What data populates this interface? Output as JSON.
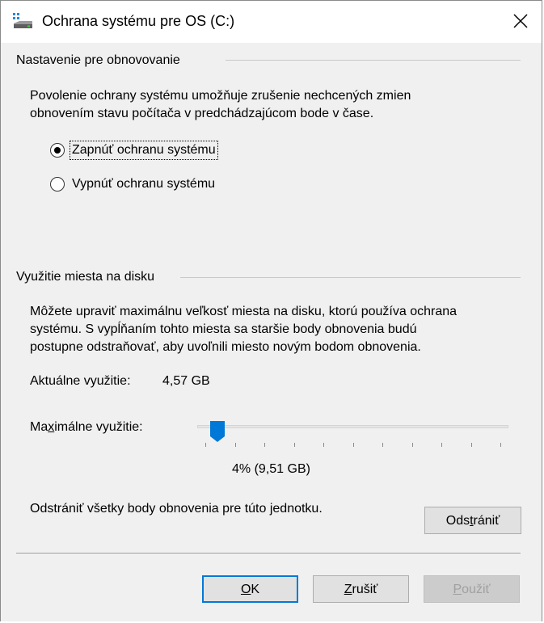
{
  "window": {
    "title": "Ochrana systému pre OS (C:)",
    "icon": "system-protection-icon"
  },
  "restore_settings": {
    "heading": "Nastavenie pre obnovovanie",
    "description_line1": "Povolenie ochrany systému umožňuje zrušenie nechcených zmien",
    "description_line2": "obnovením stavu počítača v predchádzajúcom bode v čase.",
    "options": [
      {
        "label": "Zapnúť ochranu systému",
        "selected": true
      },
      {
        "label": "Vypnúť ochranu systému",
        "selected": false
      }
    ]
  },
  "disk_usage": {
    "heading": "Využitie miesta na disku",
    "description_line1": "Môžete upraviť maximálnu veľkosť miesta na disku, ktorú používa ochrana",
    "description_line2": "systému. S vypĺňaním tohto miesta sa staršie body obnovenia budú",
    "description_line3": "postupne odstraňovať, aby uvoľnili miesto novým bodom obnovenia.",
    "current_label": "Aktuálne využitie:",
    "current_value": "4,57 GB",
    "max_label_pre": "Ma",
    "max_label_mnemonic": "x",
    "max_label_post": "imálne využitie:",
    "slider_percent": 4,
    "slider_value_text": "4% (9,51 GB)",
    "delete_text": "Odstrániť všetky body obnovenia pre túto jednotku.",
    "delete_button_pre": "Ods",
    "delete_button_mnemonic": "t",
    "delete_button_post": "rániť"
  },
  "buttons": {
    "ok_mnemonic": "O",
    "ok_rest": "K",
    "cancel_mnemonic": "Z",
    "cancel_rest": "rušiť",
    "apply_mnemonic": "P",
    "apply_rest": "oužiť"
  },
  "colors": {
    "accent": "#0078d7",
    "background": "#f0f0f0"
  }
}
